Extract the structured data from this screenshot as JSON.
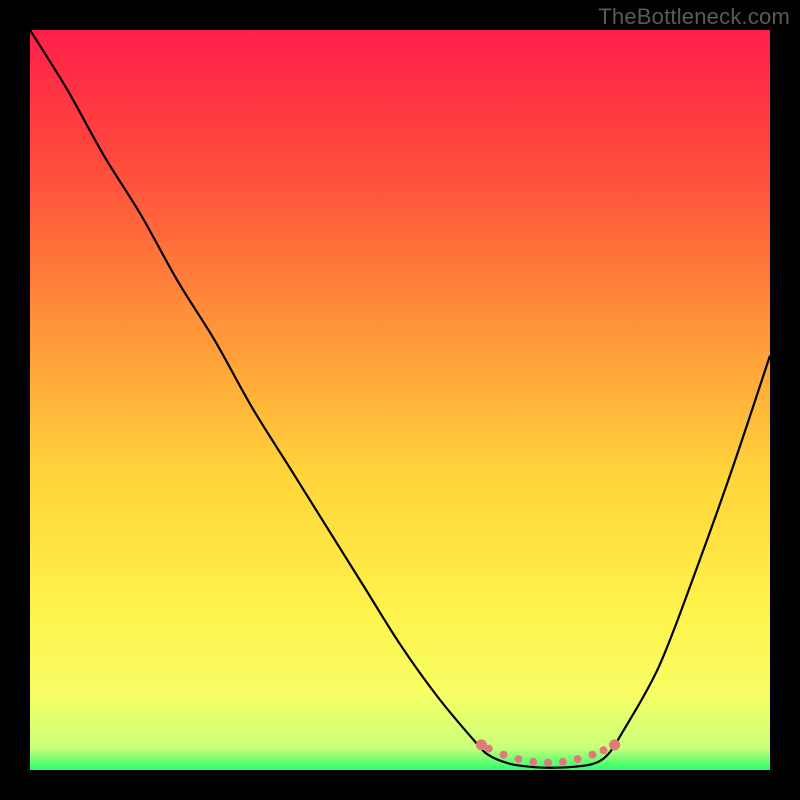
{
  "watermark": "TheBottleneck.com",
  "chart_data": {
    "type": "line",
    "title": "",
    "xlabel": "",
    "ylabel": "",
    "xlim": [
      0,
      100
    ],
    "ylim": [
      0,
      100
    ],
    "grid": false,
    "legend": false,
    "gradient_stops": [
      {
        "offset": 0,
        "color": "#ff1f4a"
      },
      {
        "offset": 18,
        "color": "#ff4a3c"
      },
      {
        "offset": 40,
        "color": "#ff943a"
      },
      {
        "offset": 60,
        "color": "#ffd43a"
      },
      {
        "offset": 78,
        "color": "#fff24a"
      },
      {
        "offset": 90,
        "color": "#f7ff66"
      },
      {
        "offset": 97,
        "color": "#c9ff7a"
      },
      {
        "offset": 100,
        "color": "#2bff6a"
      }
    ],
    "series": [
      {
        "name": "curve",
        "color": "#000000",
        "x": [
          0,
          5,
          10,
          15,
          20,
          25,
          30,
          35,
          40,
          45,
          50,
          55,
          60,
          62,
          65,
          68,
          70,
          73,
          76,
          78,
          80,
          85,
          90,
          95,
          100
        ],
        "y": [
          100,
          92,
          83,
          75,
          66,
          58,
          49,
          41,
          33,
          25,
          17,
          10,
          4,
          2,
          0.8,
          0.4,
          0.3,
          0.4,
          0.8,
          2,
          5,
          14,
          27,
          41,
          56
        ]
      }
    ],
    "annotations": {
      "flat_bottom_highlight": {
        "color": "#e07a7a",
        "x_range": [
          61,
          79
        ],
        "y_approx": 1,
        "dots_x": [
          61,
          62,
          64,
          66,
          68,
          70,
          72,
          74,
          76,
          77.5,
          79
        ]
      }
    }
  }
}
